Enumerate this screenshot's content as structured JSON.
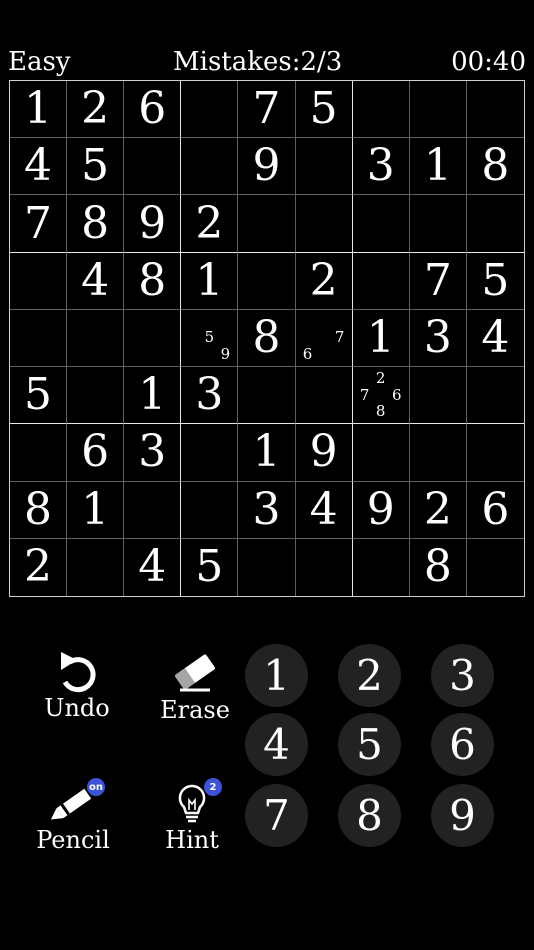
{
  "header": {
    "difficulty": "Easy",
    "mistakes": "Mistakes:2/3",
    "timer": "00:40"
  },
  "board": {
    "values": [
      [
        "1",
        "2",
        "6",
        "",
        "7",
        "5",
        "",
        "",
        ""
      ],
      [
        "4",
        "5",
        "",
        "",
        "9",
        "",
        "3",
        "1",
        "8"
      ],
      [
        "7",
        "8",
        "9",
        "2",
        "",
        "",
        "",
        "",
        ""
      ],
      [
        "",
        "4",
        "8",
        "1",
        "",
        "2",
        "",
        "7",
        "5"
      ],
      [
        "",
        "",
        "",
        "",
        "8",
        "",
        "1",
        "3",
        "4"
      ],
      [
        "5",
        "",
        "1",
        "3",
        "",
        "",
        "",
        "",
        ""
      ],
      [
        "",
        "6",
        "3",
        "",
        "1",
        "9",
        "",
        "",
        ""
      ],
      [
        "8",
        "1",
        "",
        "",
        "3",
        "4",
        "9",
        "2",
        "6"
      ],
      [
        "2",
        "",
        "4",
        "5",
        "",
        "",
        "",
        "8",
        ""
      ]
    ],
    "notes": {
      "4-3": [
        "5",
        "9"
      ],
      "4-5": [
        "6",
        "7"
      ],
      "5-6": [
        "2",
        "7",
        "8",
        "6"
      ]
    }
  },
  "controls": {
    "undo_label": "Undo",
    "erase_label": "Erase",
    "pencil_label": "Pencil",
    "pencil_state": "on",
    "hint_label": "Hint",
    "hint_count": "2"
  },
  "numpad": [
    "1",
    "2",
    "3",
    "4",
    "5",
    "6",
    "7",
    "8",
    "9"
  ],
  "colors": {
    "background": "#000000",
    "text": "#ffffff",
    "numpad_button": "#222222",
    "badge": "#3c52d9"
  },
  "icons": {
    "undo": "undo-arrow-icon",
    "erase": "eraser-icon",
    "pencil": "pencil-icon",
    "hint": "lightbulb-icon"
  }
}
